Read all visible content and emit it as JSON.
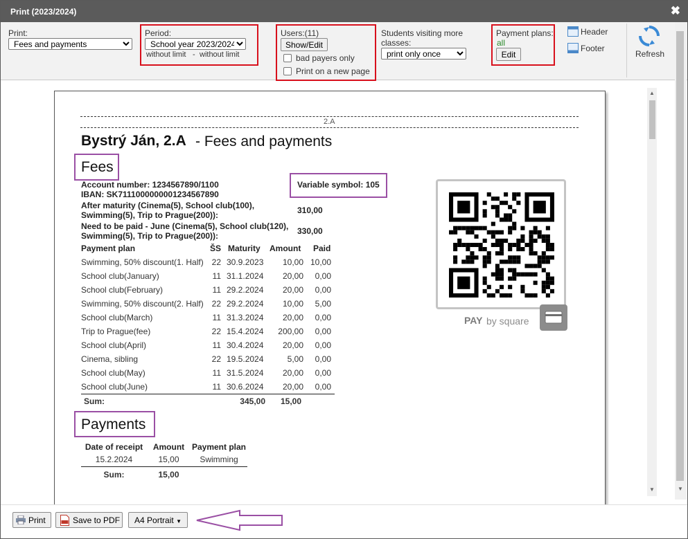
{
  "window": {
    "title": "Print (2023/2024)",
    "close": "✖"
  },
  "toolbar": {
    "print_label": "Print:",
    "print_value": "Fees and payments",
    "period_label": "Period:",
    "period_value": "School year 2023/2024",
    "period_from": "without limit",
    "period_dash": "-",
    "period_to": "without limit",
    "users_label": "Users:(11)",
    "show_edit": "Show/Edit",
    "bad_payers": "bad payers only",
    "new_page": "Print on a new page",
    "students_label_1": "Students visiting more",
    "students_label_2": "classes:",
    "students_value": "print only once",
    "plans_label": "Payment plans:",
    "plans_value": "all",
    "plans_edit": "Edit",
    "header": "Header",
    "footer": "Footer",
    "refresh": "Refresh"
  },
  "doc": {
    "class_line": "2.A",
    "student_name": "Bystrý Ján, 2.A",
    "title_suffix": "- Fees and payments",
    "fees_heading": "Fees",
    "account": "Account number: 1234567890/1100",
    "iban": "IBAN: SK7111000000001234567890",
    "variable_symbol": "Variable symbol: 105",
    "after_maturity_1": "After maturity (Cinema(5), School club(100),",
    "after_maturity_2": "Swimming(5), Trip to Prague(200)):",
    "after_maturity_amount": "310,00",
    "need_paid_1": "Need to be paid - June (Cinema(5), School club(120),",
    "need_paid_2": "Swimming(5), Trip to Prague(200)):",
    "need_paid_amount": "330,00",
    "fees_columns": [
      "Payment plan",
      "ŠS",
      "Maturity",
      "Amount",
      "Paid"
    ],
    "fees_rows": [
      [
        "Swimming, 50% discount(1. Half)",
        "22",
        "30.9.2023",
        "10,00",
        "10,00"
      ],
      [
        "School club(January)",
        "11",
        "31.1.2024",
        "20,00",
        "0,00"
      ],
      [
        "School club(February)",
        "11",
        "29.2.2024",
        "20,00",
        "0,00"
      ],
      [
        "Swimming, 50% discount(2. Half)",
        "22",
        "29.2.2024",
        "10,00",
        "5,00"
      ],
      [
        "School club(March)",
        "11",
        "31.3.2024",
        "20,00",
        "0,00"
      ],
      [
        "Trip to Prague(fee)",
        "22",
        "15.4.2024",
        "200,00",
        "0,00"
      ],
      [
        "School club(April)",
        "11",
        "30.4.2024",
        "20,00",
        "0,00"
      ],
      [
        "Cinema, sibling",
        "22",
        "19.5.2024",
        "5,00",
        "0,00"
      ],
      [
        "School club(May)",
        "11",
        "31.5.2024",
        "20,00",
        "0,00"
      ],
      [
        "School club(June)",
        "11",
        "30.6.2024",
        "20,00",
        "0,00"
      ]
    ],
    "fees_sum_label": "Sum:",
    "fees_sum_amount": "345,00",
    "fees_sum_paid": "15,00",
    "payments_heading": "Payments",
    "payments_columns": [
      "Date of receipt",
      "Amount",
      "Payment plan"
    ],
    "payments_rows": [
      [
        "15.2.2024",
        "15,00",
        "Swimming"
      ]
    ],
    "payments_sum_label": "Sum:",
    "payments_sum_amount": "15,00",
    "qr_caption_bold": "PAY",
    "qr_caption_rest": "by square"
  },
  "footer": {
    "print": "Print",
    "save_pdf": "Save to PDF",
    "orientation": "A4 Portrait"
  },
  "colors": {
    "titlebar": "#5b5b5b",
    "highlight_red": "#d8101c",
    "highlight_purple": "#9a4fa4",
    "plans_green": "#2a8a2a"
  }
}
